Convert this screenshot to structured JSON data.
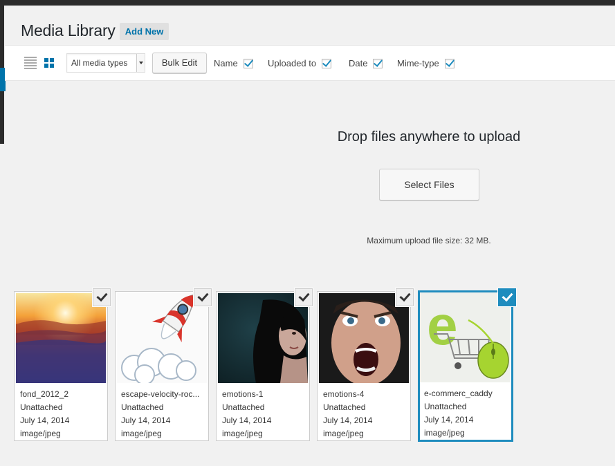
{
  "header": {
    "title": "Media Library",
    "add_new": "Add New"
  },
  "toolbar": {
    "filter_selected": "All media types",
    "bulk_edit": "Bulk Edit",
    "columns": [
      {
        "label": "Name",
        "checked": true
      },
      {
        "label": "Uploaded to",
        "checked": true
      },
      {
        "label": "Date",
        "checked": true
      },
      {
        "label": "Mime-type",
        "checked": true
      }
    ]
  },
  "uploader": {
    "title": "Drop files anywhere to upload",
    "button": "Select Files",
    "max_size": "Maximum upload file size: 32 MB."
  },
  "items": [
    {
      "name": "fond_2012_2",
      "attached": "Unattached",
      "date": "July 14, 2014",
      "mime": "image/jpeg",
      "selected": false
    },
    {
      "name": "escape-velocity-roc...",
      "attached": "Unattached",
      "date": "July 14, 2014",
      "mime": "image/jpeg",
      "selected": false
    },
    {
      "name": "emotions-1",
      "attached": "Unattached",
      "date": "July 14, 2014",
      "mime": "image/jpeg",
      "selected": false
    },
    {
      "name": "emotions-4",
      "attached": "Unattached",
      "date": "July 14, 2014",
      "mime": "image/jpeg",
      "selected": false
    },
    {
      "name": "e-commerc_caddy",
      "attached": "Unattached",
      "date": "July 14, 2014",
      "mime": "image/jpeg",
      "selected": true
    }
  ],
  "colors": {
    "accent": "#0073aa",
    "selection": "#1e8cbe",
    "admin_bar": "#2b2b2b"
  }
}
